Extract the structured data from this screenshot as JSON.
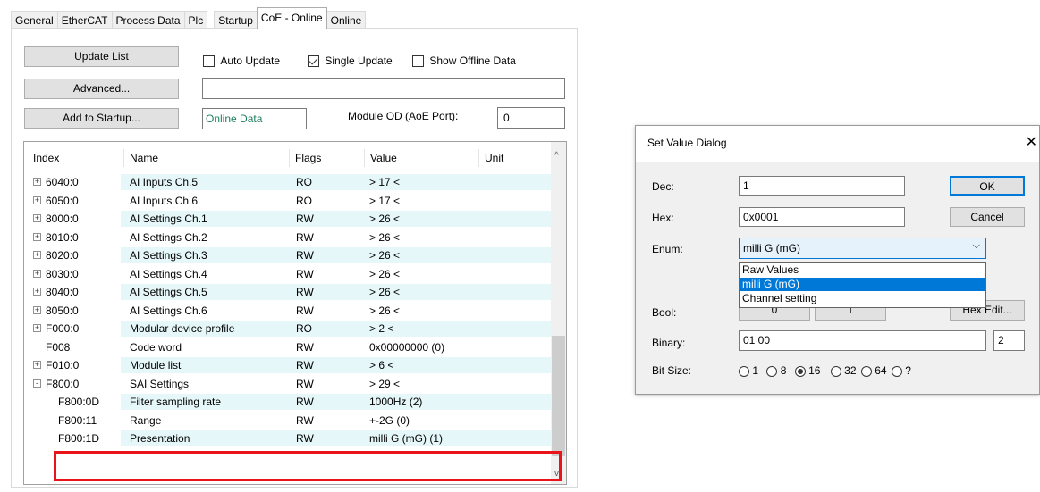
{
  "tabs": [
    "General",
    "EtherCAT",
    "Process Data",
    "Plc",
    "Startup",
    "CoE - Online",
    "Online"
  ],
  "toolbar": {
    "update_list": "Update List",
    "advanced": "Advanced...",
    "add_to_startup": "Add to Startup...",
    "auto_update": "Auto Update",
    "single_update": "Single Update",
    "show_offline": "Show Offline Data",
    "online_data": "Online Data",
    "module_od_label": "Module OD (AoE Port):",
    "module_od_value": "0"
  },
  "grid": {
    "columns": [
      "Index",
      "Name",
      "Flags",
      "Value",
      "Unit"
    ],
    "rows": [
      {
        "expand": "+",
        "index": "6040:0",
        "name": "AI Inputs Ch.5",
        "flags": "RO",
        "value": "> 17 <"
      },
      {
        "expand": "+",
        "index": "6050:0",
        "name": "AI Inputs Ch.6",
        "flags": "RO",
        "value": "> 17 <"
      },
      {
        "expand": "+",
        "index": "8000:0",
        "name": "AI Settings Ch.1",
        "flags": "RW",
        "value": "> 26 <"
      },
      {
        "expand": "+",
        "index": "8010:0",
        "name": "AI Settings Ch.2",
        "flags": "RW",
        "value": "> 26 <"
      },
      {
        "expand": "+",
        "index": "8020:0",
        "name": "AI Settings Ch.3",
        "flags": "RW",
        "value": "> 26 <"
      },
      {
        "expand": "+",
        "index": "8030:0",
        "name": "AI Settings Ch.4",
        "flags": "RW",
        "value": "> 26 <"
      },
      {
        "expand": "+",
        "index": "8040:0",
        "name": "AI Settings Ch.5",
        "flags": "RW",
        "value": "> 26 <"
      },
      {
        "expand": "+",
        "index": "8050:0",
        "name": "AI Settings Ch.6",
        "flags": "RW",
        "value": "> 26 <"
      },
      {
        "expand": "+",
        "index": "F000:0",
        "name": "Modular device profile",
        "flags": "RO",
        "value": "> 2 <"
      },
      {
        "expand": "",
        "index": "F008",
        "name": "Code word",
        "flags": "RW",
        "value": "0x00000000 (0)"
      },
      {
        "expand": "+",
        "index": "F010:0",
        "name": "Module list",
        "flags": "RW",
        "value": "> 6 <"
      },
      {
        "expand": "-",
        "index": "F800:0",
        "name": "SAI Settings",
        "flags": "RW",
        "value": "> 29 <"
      },
      {
        "expand": "",
        "index": "F800:0D",
        "name": "Filter sampling rate",
        "flags": "RW",
        "value": "1000Hz (2)"
      },
      {
        "expand": "",
        "index": "F800:11",
        "name": "Range",
        "flags": "RW",
        "value": "+-2G (0)"
      },
      {
        "expand": "",
        "index": "F800:1D",
        "name": "Presentation",
        "flags": "RW",
        "value": "milli G (mG) (1)"
      }
    ]
  },
  "dialog": {
    "title": "Set Value Dialog",
    "dec_label": "Dec:",
    "dec_value": "1",
    "hex_label": "Hex:",
    "hex_value": "0x0001",
    "enum_label": "Enum:",
    "enum_value": "milli G (mG)",
    "enum_options": [
      "Raw Values",
      "milli G (mG)",
      "Channel setting"
    ],
    "bool_label": "Bool:",
    "bool_false": "0",
    "bool_true": "1",
    "hex_edit": "Hex Edit...",
    "binary_label": "Binary:",
    "binary_value": "01 00",
    "binary_size": "2",
    "bitsize_label": "Bit Size:",
    "bitsize_options": [
      "1",
      "8",
      "16",
      "32",
      "64",
      "?"
    ],
    "ok": "OK",
    "cancel": "Cancel",
    "close_glyph": "✕"
  }
}
